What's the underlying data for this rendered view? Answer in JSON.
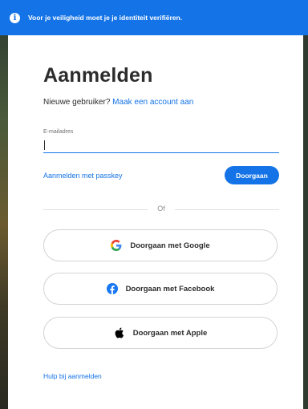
{
  "banner": {
    "text": "Voor je veiligheid moet je je identiteit verifiëren.",
    "icon": "info-icon"
  },
  "signin": {
    "title": "Aanmelden",
    "new_user_prefix": "Nieuwe gebruiker?",
    "create_account_link": "Maak een account aan",
    "email_label": "E-mailadres",
    "email_value": "",
    "passkey_link": "Aanmelden met passkey",
    "continue_label": "Doorgaan",
    "or_text": "Of",
    "help_link": "Hulp bij aanmelden"
  },
  "social": [
    {
      "label": "Doorgaan met Google",
      "icon": "google-icon"
    },
    {
      "label": "Doorgaan met Facebook",
      "icon": "facebook-icon"
    },
    {
      "label": "Doorgaan met Apple",
      "icon": "apple-icon"
    }
  ],
  "colors": {
    "accent": "#1473e6",
    "text": "#2c2c2c",
    "border": "#d3d3d3"
  }
}
